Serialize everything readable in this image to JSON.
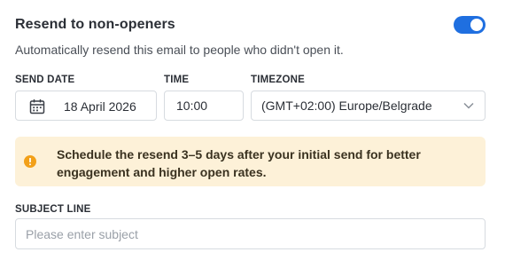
{
  "section": {
    "title": "Resend to non-openers",
    "toggle_on": true,
    "description": "Automatically resend this email to people who didn't open it."
  },
  "schedule": {
    "send_date": {
      "label": "SEND DATE",
      "value": "18 April 2026",
      "icon": "calendar-icon"
    },
    "time": {
      "label": "TIME",
      "value": "10:00"
    },
    "timezone": {
      "label": "TIMEZONE",
      "value": "(GMT+02:00) Europe/Belgrade",
      "icon": "chevron-down-icon"
    }
  },
  "notice": {
    "icon": "warning-icon",
    "text": "Schedule the resend 3–5 days after your initial send for better engagement and higher open rates.",
    "background": "#fdf1d8",
    "icon_color": "#f2a019"
  },
  "subject": {
    "label": "SUBJECT LINE",
    "value": "",
    "placeholder": "Please enter subject"
  },
  "colors": {
    "accent": "#1f6fe0"
  }
}
